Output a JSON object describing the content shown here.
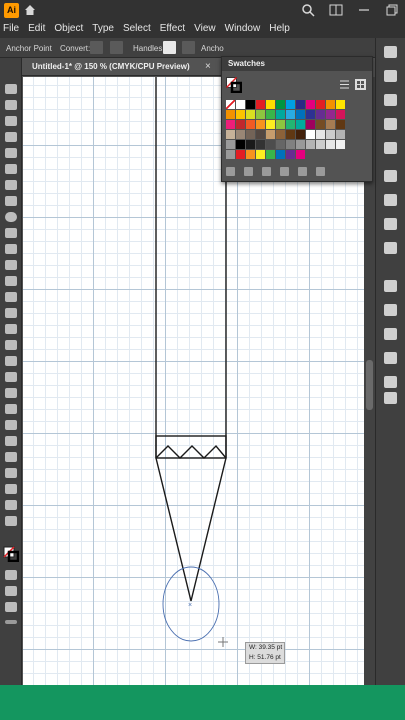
{
  "app": {
    "logo": "Ai"
  },
  "menu": [
    "File",
    "Edit",
    "Object",
    "Type",
    "Select",
    "Effect",
    "View",
    "Window",
    "Help"
  ],
  "control_bar": {
    "anchor_point": "Anchor Point",
    "convert": "Convert:",
    "handles": "Handles:",
    "anchors": "Ancho"
  },
  "document": {
    "tab_title": "Untitled-1* @ 150 % (CMYK/CPU Preview)",
    "close": "×"
  },
  "swatches": {
    "title": "Swatches",
    "rows": [
      [
        "none",
        "#ffffff",
        "#000000",
        "#e31e24",
        "#ffde00",
        "#009640",
        "#00a0e3",
        "#2b2a84",
        "#e5007e",
        "#e31e24",
        "#f39200",
        "#ffe600"
      ],
      [
        "#f39200",
        "#fcc400",
        "#d9e021",
        "#8dc63f",
        "#39b54a",
        "#00a99d",
        "#29abe2",
        "#0071bc",
        "#2e3192",
        "#662d91",
        "#93278f",
        "#d4145a"
      ],
      [
        "#ed1e79",
        "#c1272d",
        "#f15a24",
        "#f7931e",
        "#fcee21",
        "#8cc63f",
        "#22b573",
        "#00a99d",
        "#9e005d",
        "#754c24",
        "#a67c52",
        "#603813"
      ],
      [
        "#c7b299",
        "#998675",
        "#736357",
        "#534741",
        "#c69c6d",
        "#8c6239",
        "#603813",
        "#42210b",
        "#ffffff",
        "#e6e6e6",
        "#cccccc",
        "#b3b3b3"
      ],
      [
        "group",
        "#000000",
        "#1a1a1a",
        "#333333",
        "#4d4d4d",
        "#666666",
        "#808080",
        "#999999",
        "#b3b3b3",
        "#cccccc",
        "#e6e6e6",
        "#f2f2f2"
      ],
      [
        "group",
        "#e31e24",
        "#f7931e",
        "#fcee21",
        "#39b54a",
        "#0071bc",
        "#662d91",
        "#e5007e"
      ]
    ]
  },
  "measure": {
    "width": "W: 39.35 pt",
    "height": "H: 51.76 pt"
  }
}
